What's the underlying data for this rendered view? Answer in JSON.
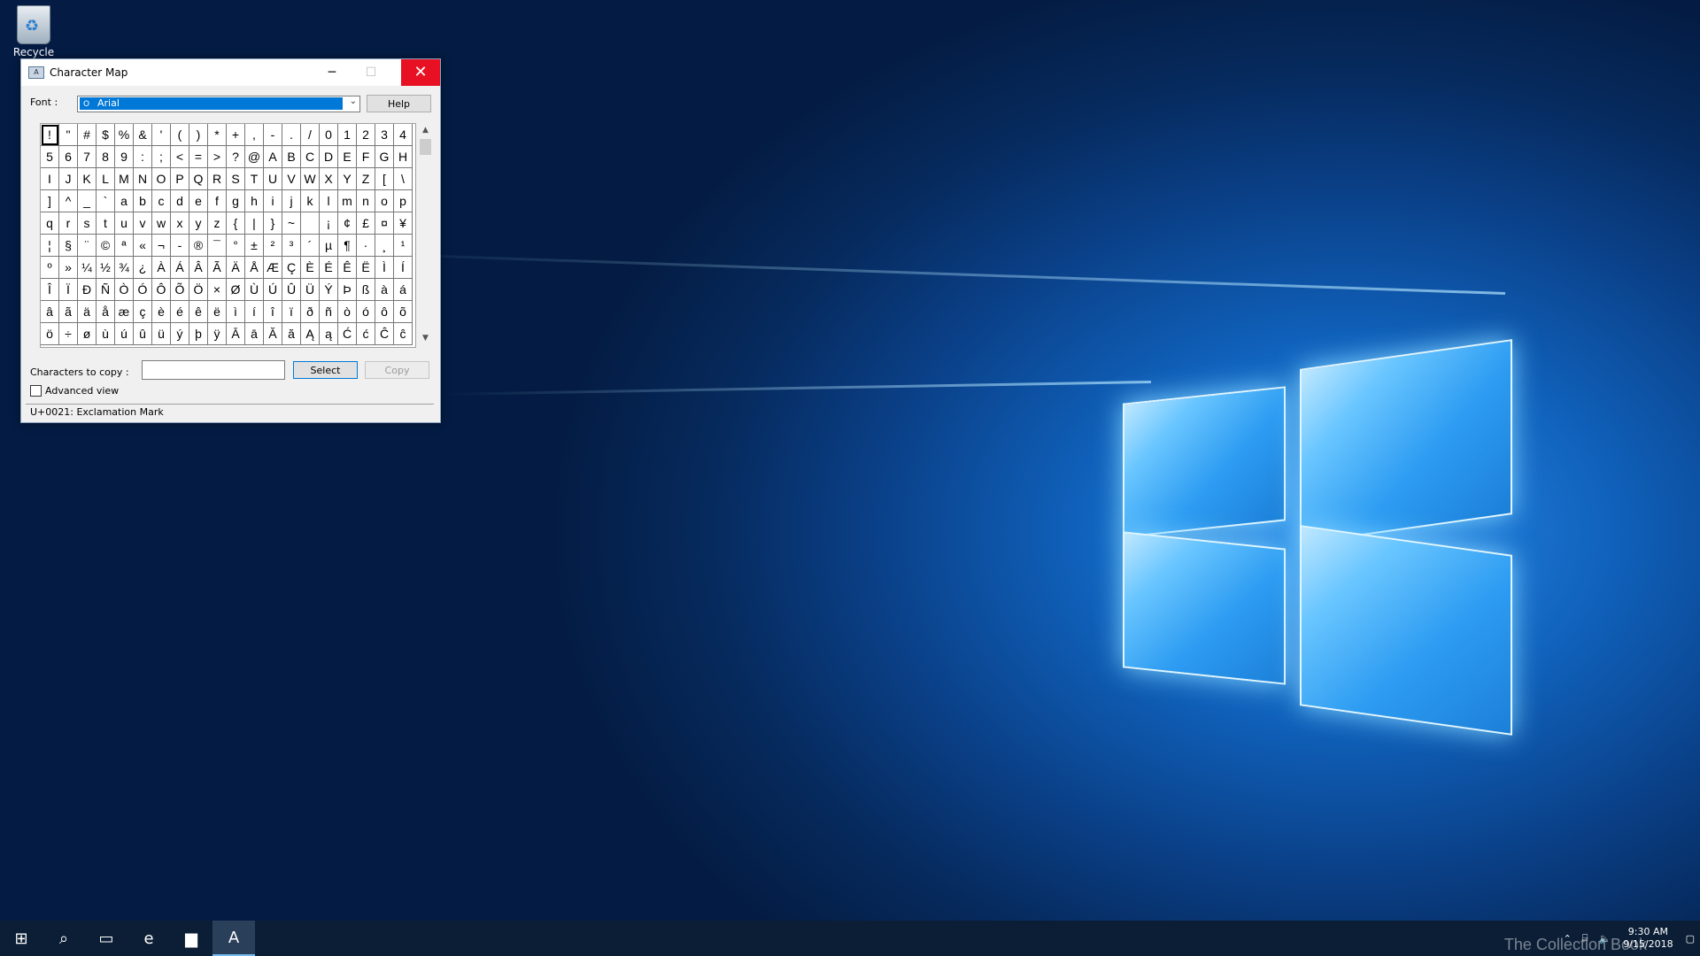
{
  "desktop": {
    "recycle_bin_label": "Recycle Bin"
  },
  "window": {
    "title": "Character Map",
    "font_label": "Font :",
    "font_value": "Arial",
    "help_label": "Help",
    "chars_to_copy_label": "Characters to copy :",
    "chars_to_copy_value": "",
    "select_label": "Select",
    "copy_label": "Copy",
    "advanced_view_label": "Advanced view",
    "advanced_view_checked": false,
    "status_text": "U+0021: Exclamation Mark",
    "characters": [
      "!",
      "\"",
      "#",
      "$",
      "%",
      "&",
      "'",
      "(",
      ")",
      "*",
      "+",
      ",",
      "-",
      ".",
      "/",
      "0",
      "1",
      "2",
      "3",
      "4",
      "5",
      "6",
      "7",
      "8",
      "9",
      ":",
      ";",
      "<",
      "=",
      ">",
      "?",
      "@",
      "A",
      "B",
      "C",
      "D",
      "E",
      "F",
      "G",
      "H",
      "I",
      "J",
      "K",
      "L",
      "M",
      "N",
      "O",
      "P",
      "Q",
      "R",
      "S",
      "T",
      "U",
      "V",
      "W",
      "X",
      "Y",
      "Z",
      "[",
      "\\",
      "]",
      "^",
      "_",
      "`",
      "a",
      "b",
      "c",
      "d",
      "e",
      "f",
      "g",
      "h",
      "i",
      "j",
      "k",
      "l",
      "m",
      "n",
      "o",
      "p",
      "q",
      "r",
      "s",
      "t",
      "u",
      "v",
      "w",
      "x",
      "y",
      "z",
      "{",
      "|",
      "}",
      "~",
      " ",
      "¡",
      "¢",
      "£",
      "¤",
      "¥",
      "¦",
      "§",
      "¨",
      "©",
      "ª",
      "«",
      "¬",
      "-",
      "®",
      "¯",
      "°",
      "±",
      "²",
      "³",
      "´",
      "µ",
      "¶",
      "·",
      "¸",
      "¹",
      "º",
      "»",
      "¼",
      "½",
      "¾",
      "¿",
      "À",
      "Á",
      "Â",
      "Ã",
      "Ä",
      "Å",
      "Æ",
      "Ç",
      "È",
      "É",
      "Ê",
      "Ë",
      "Ì",
      "Í",
      "Î",
      "Ï",
      "Ð",
      "Ñ",
      "Ò",
      "Ó",
      "Ô",
      "Õ",
      "Ö",
      "×",
      "Ø",
      "Ù",
      "Ú",
      "Û",
      "Ü",
      "Ý",
      "Þ",
      "ß",
      "à",
      "á",
      "â",
      "ã",
      "ä",
      "å",
      "æ",
      "ç",
      "è",
      "é",
      "ê",
      "ë",
      "ì",
      "í",
      "î",
      "ï",
      "ð",
      "ñ",
      "ò",
      "ó",
      "ô",
      "õ",
      "ö",
      "÷",
      "ø",
      "ù",
      "ú",
      "û",
      "ü",
      "ý",
      "þ",
      "ÿ",
      "Ā",
      "ā",
      "Ă",
      "ă",
      "Ą",
      "ą",
      "Ć",
      "ć",
      "Ĉ",
      "ĉ"
    ],
    "selected_index": 0
  },
  "taskbar": {
    "items": [
      {
        "name": "start-icon",
        "glyph": "⊞"
      },
      {
        "name": "search-icon",
        "glyph": "⌕"
      },
      {
        "name": "task-view-icon",
        "glyph": "▭"
      },
      {
        "name": "edge-browser-icon",
        "glyph": "e"
      },
      {
        "name": "file-explorer-icon",
        "glyph": "▆"
      },
      {
        "name": "character-map-taskbar-icon",
        "glyph": "A"
      }
    ],
    "time": "9:30 AM",
    "date": "9/15/2018"
  },
  "watermark": "The Collection Book"
}
